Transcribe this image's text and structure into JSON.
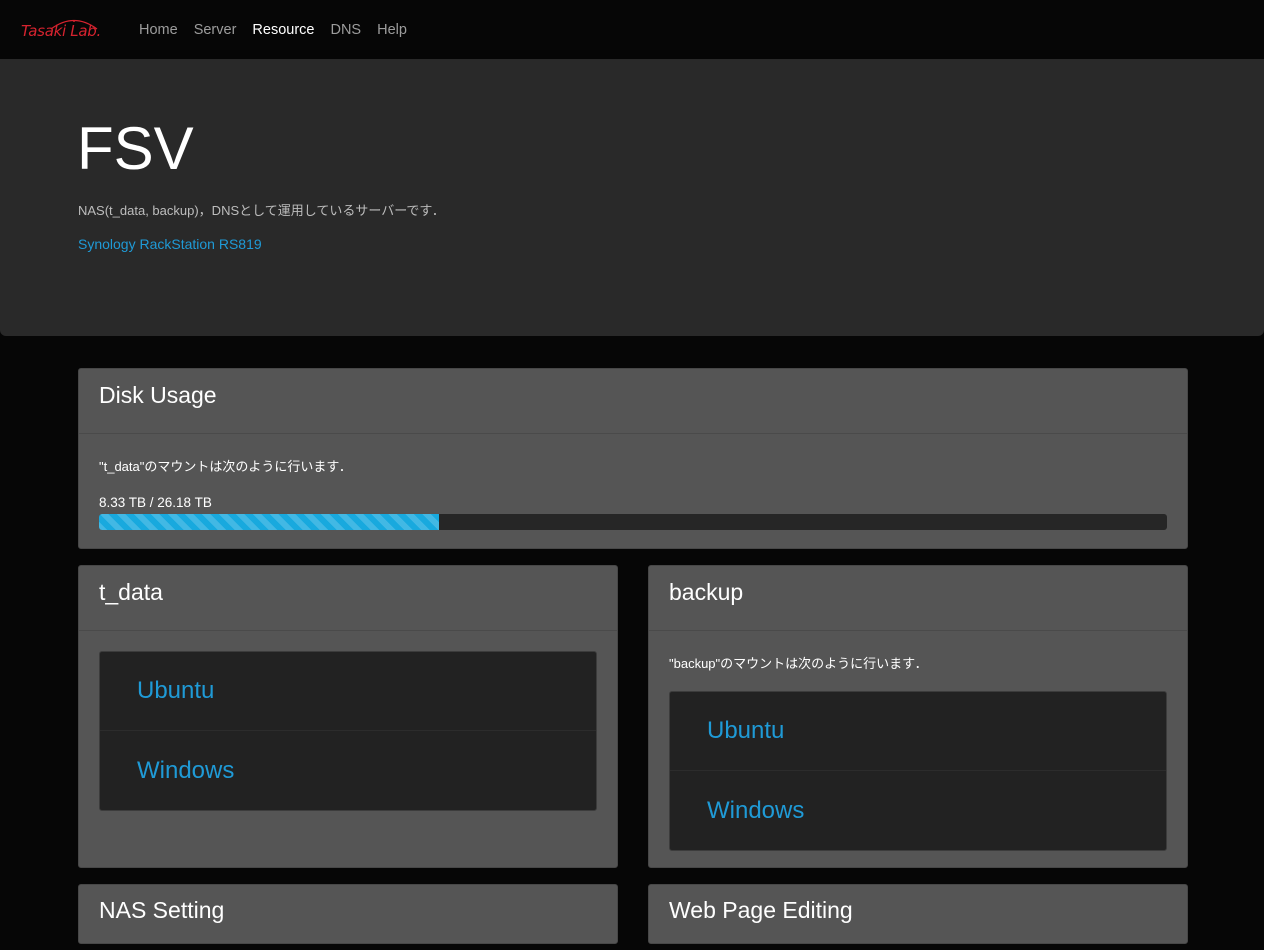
{
  "navbar": {
    "brand": "Tasaki Lab.",
    "links": [
      "Home",
      "Server",
      "Resource",
      "DNS",
      "Help"
    ],
    "active": "Resource"
  },
  "jumbotron": {
    "title": "FSV",
    "description": "NAS(t_data, backup)，DNSとして運用しているサーバーです．",
    "link": "Synology RackStation RS819"
  },
  "disk_usage": {
    "title": "Disk Usage",
    "mount_text": "\"t_data\"のマウントは次のように行います．",
    "usage_label": "8.33 TB / 26.18 TB",
    "used_tb": 8.33,
    "total_tb": 26.18
  },
  "t_data": {
    "title": "t_data",
    "items": [
      "Ubuntu",
      "Windows"
    ]
  },
  "backup": {
    "title": "backup",
    "mount_text": "\"backup\"のマウントは次のように行います．",
    "items": [
      "Ubuntu",
      "Windows"
    ]
  },
  "nas_setting": {
    "title": "NAS Setting"
  },
  "web_page_editing": {
    "title": "Web Page Editing"
  },
  "colors": {
    "accent": "#1f9ad6",
    "progress": "#18a9de",
    "brand": "#d6232f",
    "card": "#555555",
    "jumbotron": "#292929"
  }
}
